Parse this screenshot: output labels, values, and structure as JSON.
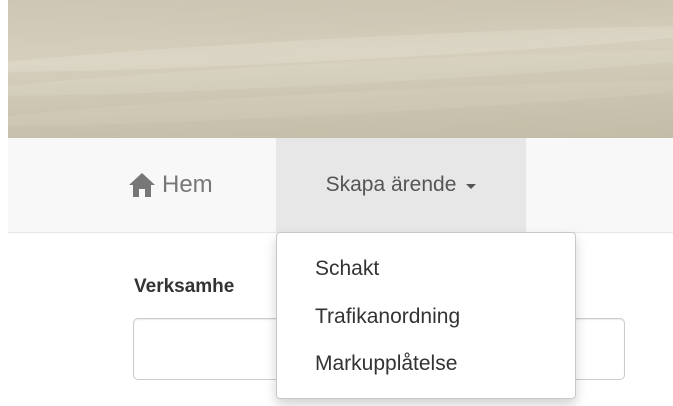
{
  "nav": {
    "home_label": "Hem",
    "home_icon": "home-icon",
    "create_label": "Skapa ärende",
    "create_icon": "caret-down-icon"
  },
  "dropdown": {
    "items": [
      {
        "label": "Schakt"
      },
      {
        "label": "Trafikanordning"
      },
      {
        "label": "Markupplåtelse"
      }
    ]
  },
  "form": {
    "field_label": "Verksamhe",
    "field_value": ""
  },
  "colors": {
    "navbar_bg": "#f8f8f8",
    "active_nav_bg": "#e7e7e7",
    "nav_text": "#777777",
    "hero_bg": "#d2cbb8"
  }
}
